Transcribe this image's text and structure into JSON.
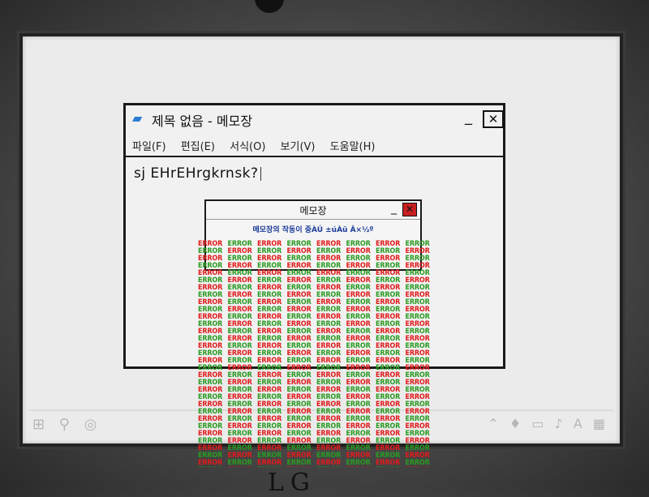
{
  "notepad": {
    "title": "제목 없음 - 메모장",
    "menu": [
      "파일(F)",
      "편집(E)",
      "서식(O)",
      "보기(V)",
      "도움말(H)"
    ],
    "content": "sj EHrEHrgkrnsk?"
  },
  "dialog": {
    "title": "메모장",
    "message": "메모장의 작동이 중ÀÚ ±úÀü Â×½º"
  },
  "error_word": "ERROR",
  "bottom_label": "LG",
  "colors": {
    "error_red": "#e01b1b",
    "error_green": "#2c9a22",
    "dialog_text": "#1a3a9a"
  }
}
